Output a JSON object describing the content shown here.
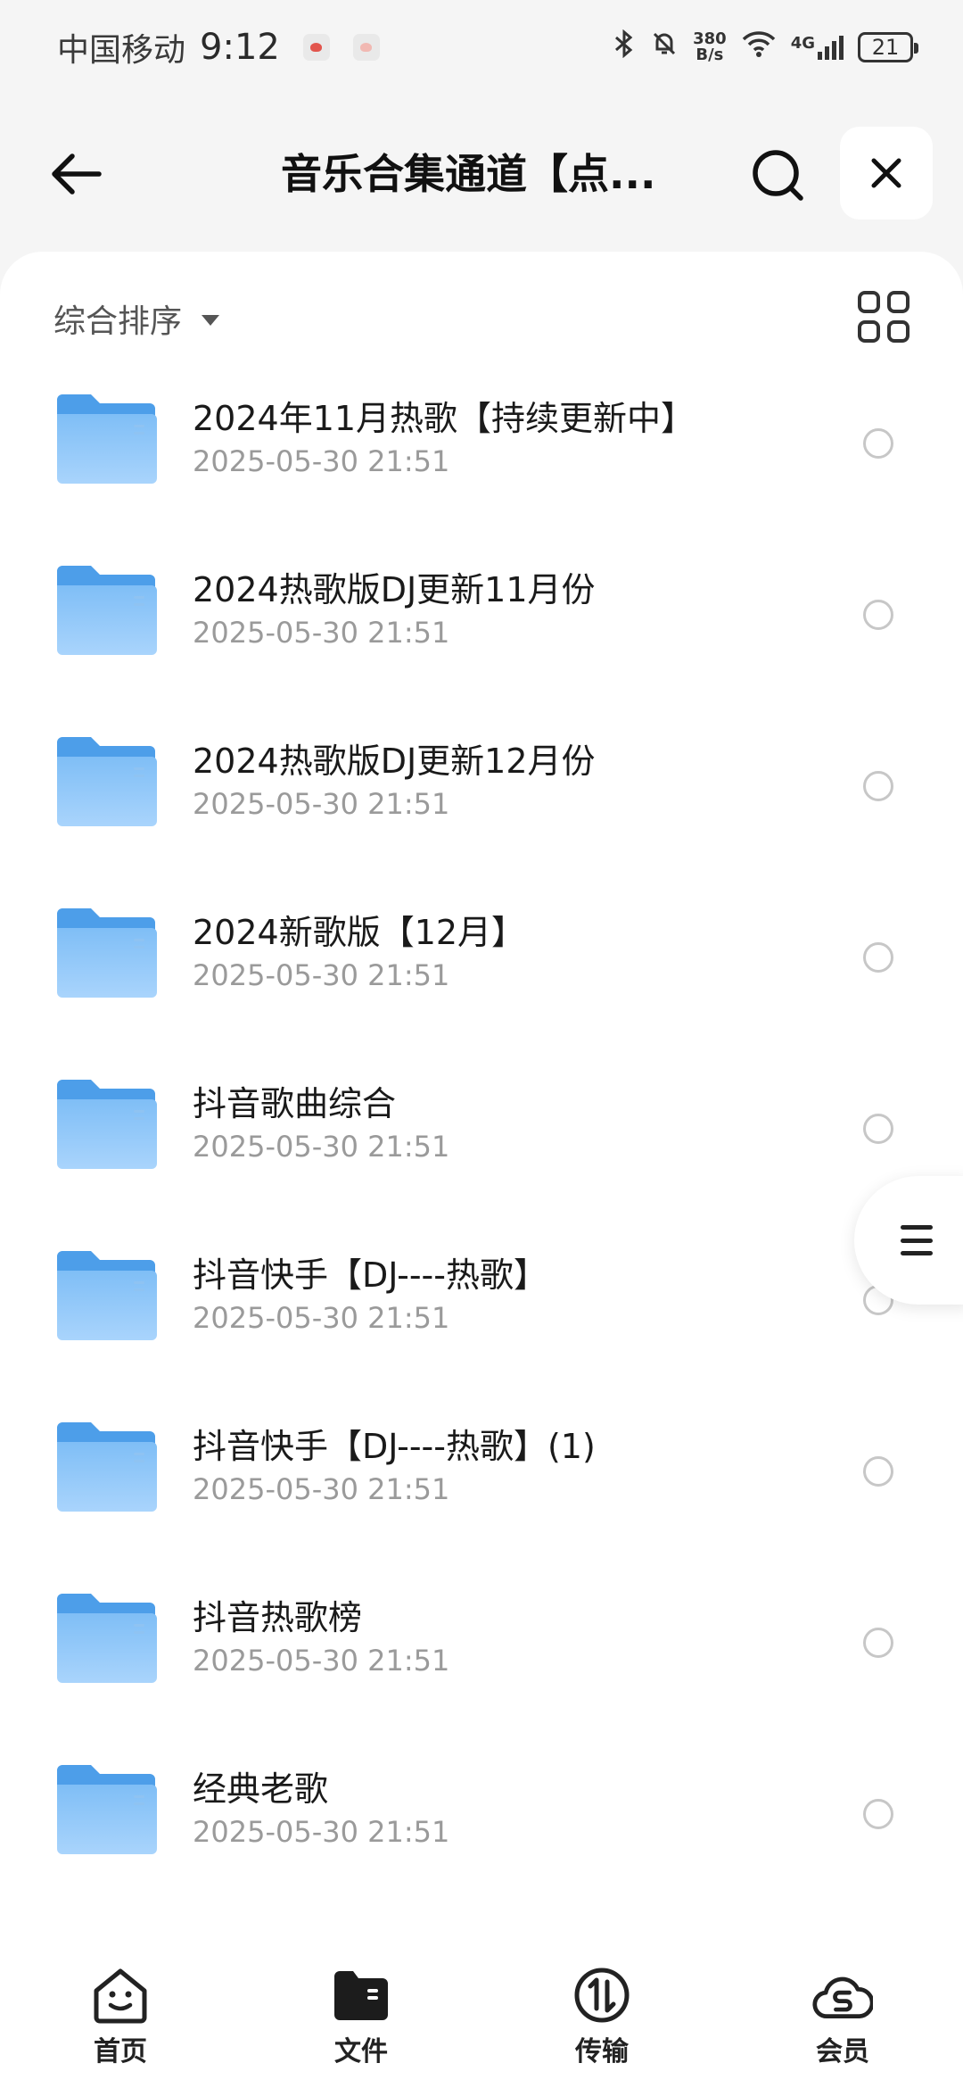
{
  "status_bar": {
    "carrier": "中国移动",
    "time": "9:12",
    "net_speed_top": "380",
    "net_speed_bottom": "B/s",
    "network_type": "4G",
    "battery": "21"
  },
  "header": {
    "title": "音乐合集通道【点...",
    "back_icon": "arrow-left-icon",
    "search_icon": "search-icon",
    "close_icon": "close-icon"
  },
  "sort": {
    "label": "综合排序"
  },
  "files": [
    {
      "name": "2024年11月热歌【持续更新中】",
      "date": "2025-05-30 21:51"
    },
    {
      "name": "2024热歌版DJ更新11月份",
      "date": "2025-05-30 21:51"
    },
    {
      "name": "2024热歌版DJ更新12月份",
      "date": "2025-05-30 21:51"
    },
    {
      "name": "2024新歌版【12月】",
      "date": "2025-05-30 21:51"
    },
    {
      "name": "抖音歌曲综合",
      "date": "2025-05-30 21:51"
    },
    {
      "name": "抖音快手【DJ----热歌】",
      "date": "2025-05-30 21:51"
    },
    {
      "name": "抖音快手【DJ----热歌】(1)",
      "date": "2025-05-30 21:51"
    },
    {
      "name": "抖音热歌榜",
      "date": "2025-05-30 21:51"
    },
    {
      "name": "经典老歌",
      "date": "2025-05-30 21:51"
    }
  ],
  "bottom_nav": [
    {
      "label": "首页",
      "icon": "home-face-icon"
    },
    {
      "label": "文件",
      "icon": "folder-icon"
    },
    {
      "label": "传输",
      "icon": "transfer-icon"
    },
    {
      "label": "会员",
      "icon": "vip-cloud-icon"
    }
  ],
  "colors": {
    "folder": "#5ba9f0",
    "folder_light": "#a8d3fb",
    "accent_dark": "#1f1f1f"
  }
}
